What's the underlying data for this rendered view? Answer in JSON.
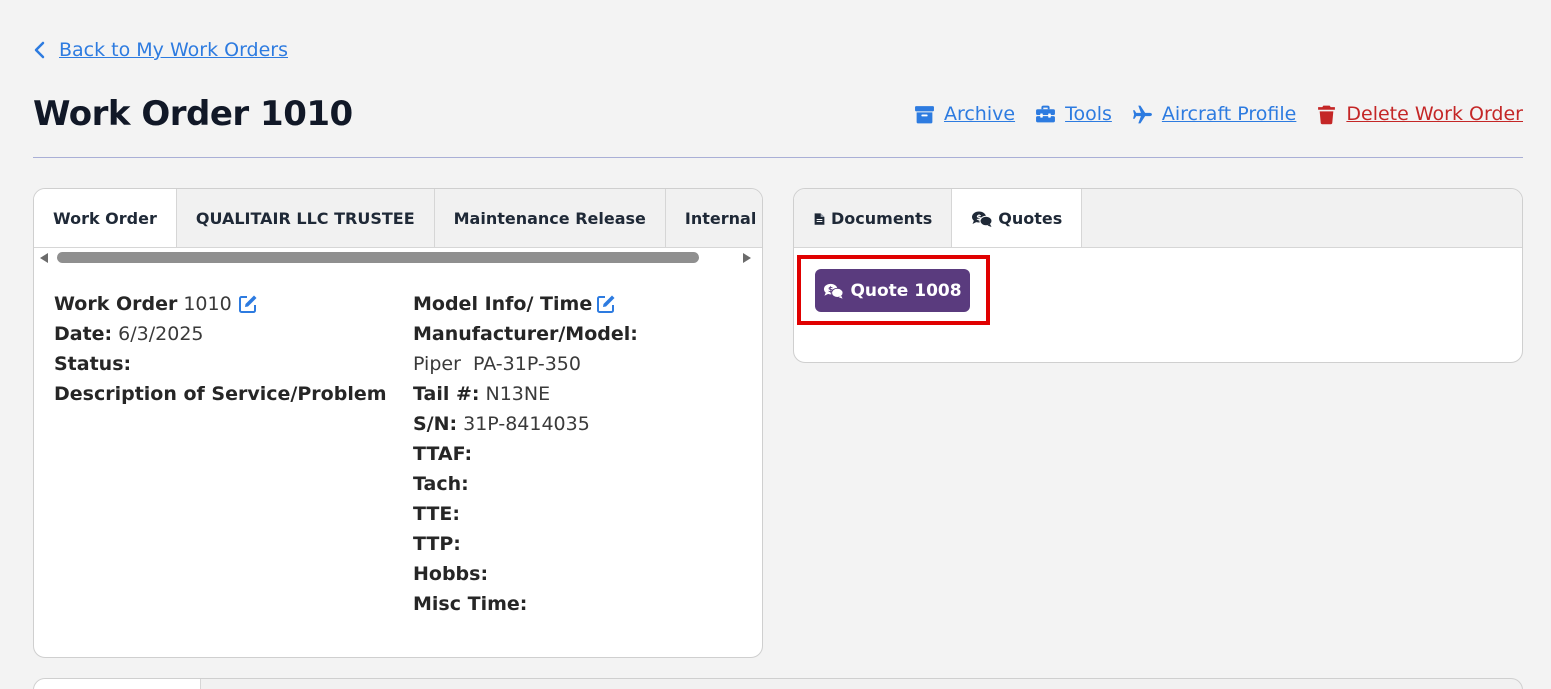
{
  "nav": {
    "back_label": "Back to My Work Orders"
  },
  "page": {
    "title": "Work Order 1010"
  },
  "actions": {
    "archive": "Archive",
    "tools": "Tools",
    "aircraft_profile": "Aircraft Profile",
    "delete": "Delete Work Order"
  },
  "left_tabs": [
    {
      "label": "Work Order"
    },
    {
      "label": "QUALITAIR LLC TRUSTEE"
    },
    {
      "label": "Maintenance Release"
    },
    {
      "label": "Internal No"
    }
  ],
  "work_order": {
    "wo_label": "Work Order",
    "wo_value": "1010",
    "date_label": "Date:",
    "date_value": "6/3/2025",
    "status_label": "Status:",
    "desc_label": "Description of Service/Problem"
  },
  "model_info": {
    "heading": "Model Info/ Time",
    "manufacturer_label": "Manufacturer/Model:",
    "manufacturer_value": "Piper  PA-31P-350",
    "tail_label": "Tail #:",
    "tail_value": "N13NE",
    "sn_label": "S/N:",
    "sn_value": "31P-8414035",
    "ttaf_label": "TTAF:",
    "tach_label": "Tach:",
    "tte_label": "TTE:",
    "ttp_label": "TTP:",
    "hobbs_label": "Hobbs:",
    "misc_label": "Misc Time:"
  },
  "right_tabs": [
    {
      "label": "Documents",
      "icon": "file-icon"
    },
    {
      "label": "Quotes",
      "icon": "quote-comments-icon"
    }
  ],
  "quotes": {
    "button_label": "Quote 1008"
  },
  "colors": {
    "link": "#2d7be0",
    "danger": "#c42626",
    "quote_button": "#5a3b7e",
    "highlight": "#e00000"
  }
}
